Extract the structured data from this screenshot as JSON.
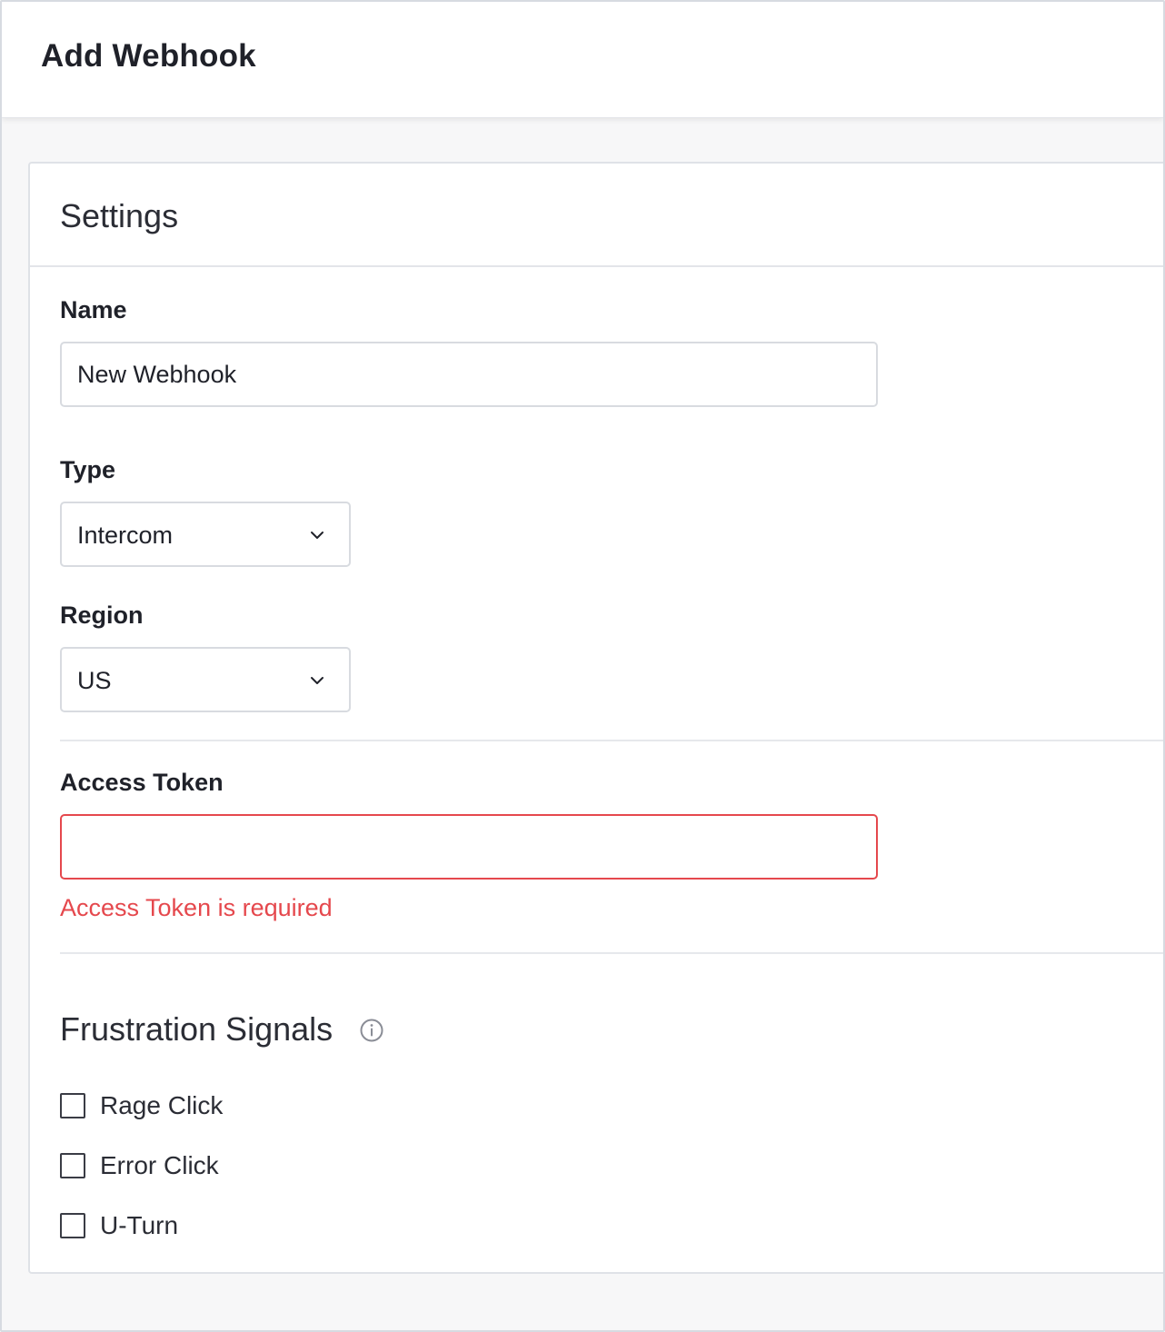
{
  "header": {
    "title": "Add Webhook"
  },
  "settings": {
    "title": "Settings",
    "name": {
      "label": "Name",
      "value": "New Webhook"
    },
    "type": {
      "label": "Type",
      "value": "Intercom"
    },
    "region": {
      "label": "Region",
      "value": "US"
    },
    "access_token": {
      "label": "Access Token",
      "value": "",
      "error": "Access Token is required"
    }
  },
  "frustration_signals": {
    "title": "Frustration Signals",
    "options": [
      {
        "label": "Rage Click",
        "checked": false
      },
      {
        "label": "Error Click",
        "checked": false
      },
      {
        "label": "U-Turn",
        "checked": false
      }
    ]
  },
  "colors": {
    "error": "#e5484d",
    "border": "#d8dbe0",
    "text": "#1f2129",
    "background": "#f7f7f8"
  }
}
